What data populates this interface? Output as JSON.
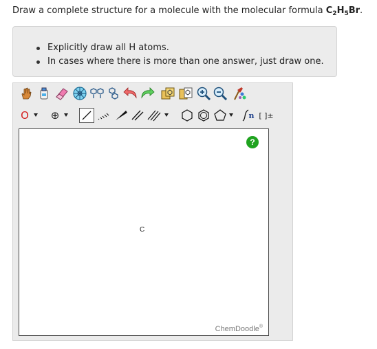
{
  "question": {
    "prefix": "Draw a complete structure for a molecule with the molecular formula ",
    "formula": [
      {
        "text": "C",
        "sub": "2"
      },
      {
        "text": "H",
        "sub": "5"
      },
      {
        "text": "Br",
        "sub": ""
      }
    ],
    "suffix": "."
  },
  "instructions": [
    "Explicitly draw all H atoms.",
    "In cases where there is more than one answer, just draw one."
  ],
  "sketcher": {
    "toolbar_row1": [
      "hand-icon",
      "eraser-bottle-icon",
      "eraser-icon",
      "center-icon",
      "copy-molecule-icon",
      "rotate-icon",
      "undo-icon",
      "redo-icon",
      "templates-icon",
      "clear-icon",
      "zoom-in-icon",
      "zoom-out-icon",
      "clean-structure-icon"
    ],
    "atom_selector_label": "O",
    "charge_label": "⊕",
    "bond_tools": [
      "single-bond-icon",
      "hash-bond-icon",
      "wedge-bond-icon",
      "double-bond-icon",
      "triple-bond-icon"
    ],
    "ring_tools": [
      "hexagon-icon",
      "benzene-icon",
      "pentagon-icon"
    ],
    "repeat_unit_label": "n",
    "bracket_label": "[ ]±",
    "canvas_atom": "C",
    "help_label": "?",
    "brand": "ChemDoodle",
    "brand_mark": "®",
    "colors": {
      "help": "#1fa31f",
      "atom_selector": "#d42020",
      "panel": "#ebebeb"
    }
  }
}
